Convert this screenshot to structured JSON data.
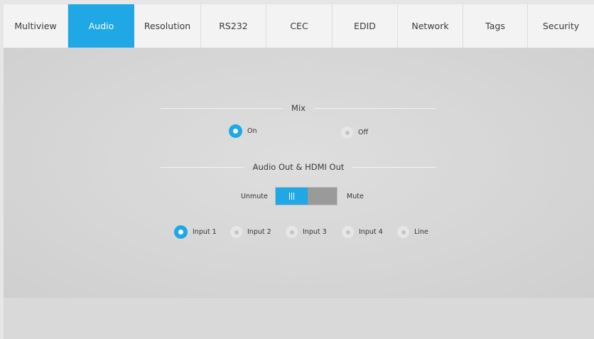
{
  "tabs": [
    {
      "label": "Multiview"
    },
    {
      "label": "Audio"
    },
    {
      "label": "Resolution"
    },
    {
      "label": "RS232"
    },
    {
      "label": "CEC"
    },
    {
      "label": "EDID"
    },
    {
      "label": "Network"
    },
    {
      "label": "Tags"
    },
    {
      "label": "Security"
    }
  ],
  "active_tab": "Audio",
  "mix": {
    "title": "Mix",
    "on_label": "On",
    "off_label": "Off",
    "selected": "On"
  },
  "audio_out": {
    "title": "Audio Out & HDMI Out",
    "unmute_label": "Unmute",
    "mute_label": "Mute",
    "toggle_state": "Unmute"
  },
  "inputs": {
    "options": [
      {
        "label": "Input 1"
      },
      {
        "label": "Input 2"
      },
      {
        "label": "Input 3"
      },
      {
        "label": "Input 4"
      },
      {
        "label": "Line"
      }
    ],
    "selected": "Input 1"
  },
  "colors": {
    "accent": "#1fa7e6",
    "tab_bar_bg": "#f3f3f3",
    "panel_bg": "#d9d9d9",
    "toggle_off_bg": "#9a9a9a"
  }
}
